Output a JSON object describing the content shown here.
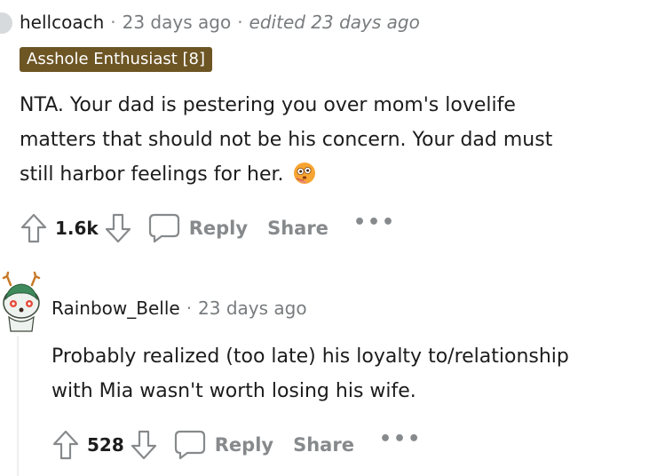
{
  "comments": [
    {
      "author": "hellcoach",
      "time": "23 days ago",
      "edited": "edited 23 days ago",
      "flair": "Asshole Enthusiast [8]",
      "body_lines": [
        "NTA. Your dad is pestering you over mom's lovelife",
        "matters that should not be his concern. Your dad must",
        "still harbor feelings for her."
      ],
      "emoji": "flushed-face-emoji",
      "score": "1.6k",
      "reply_label": "Reply",
      "share_label": "Share",
      "more_label": "•••"
    },
    {
      "author": "Rainbow_Belle",
      "time": "23 days ago",
      "body_lines": [
        "Probably realized (too late) his loyalty to/relationship",
        "with Mia wasn't worth losing his wife."
      ],
      "score": "528",
      "reply_label": "Reply",
      "share_label": "Share",
      "more_label": "•••"
    }
  ],
  "colors": {
    "flair_bg": "#6d5524",
    "muted": "#878a8c",
    "text": "#1c1c1c",
    "thread_line": "#edeff1"
  }
}
